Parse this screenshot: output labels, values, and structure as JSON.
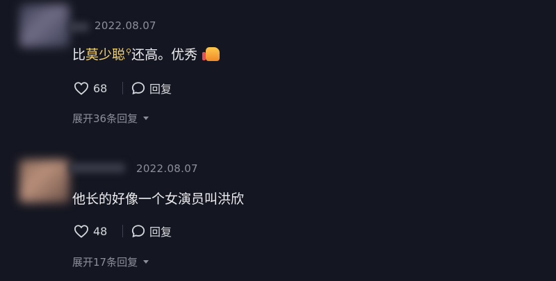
{
  "comments": [
    {
      "date": "2022.08.07",
      "text_prefix": "比",
      "mention": "莫少聪",
      "mention_icon": "search-icon",
      "text_suffix": "还高。优秀",
      "emoji": "thumbs-up-icon",
      "likes": "68",
      "reply_label": "回复",
      "expand_label": "展开36条回复"
    },
    {
      "date": "2022.08.07",
      "text": "他长的好像一个女演员叫洪欣",
      "likes": "48",
      "reply_label": "回复",
      "expand_label": "展开17条回复"
    }
  ],
  "colors": {
    "background": "#141621",
    "mention": "#f3d36b",
    "muted": "#8d8f9a",
    "text": "#eeeef2"
  }
}
